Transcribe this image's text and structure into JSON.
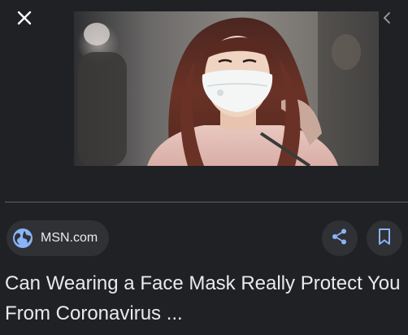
{
  "viewer": {
    "close_icon": "close-icon",
    "prev_icon": "chevron-left-icon"
  },
  "image": {
    "subject": "woman-in-face-mask-photo"
  },
  "source": {
    "label": "MSN.com",
    "icon": "globe-icon"
  },
  "actions": {
    "share_icon": "share-icon",
    "save_icon": "bookmark-icon"
  },
  "article": {
    "title_line1": "Can Wearing a Face Mask Really Protect You",
    "title_line2": "From Coronavirus ..."
  },
  "colors": {
    "background": "#202124",
    "chip_bg": "#303134",
    "text": "#e8eaed",
    "accent": "#8ab4f8",
    "divider": "#5f6368"
  }
}
